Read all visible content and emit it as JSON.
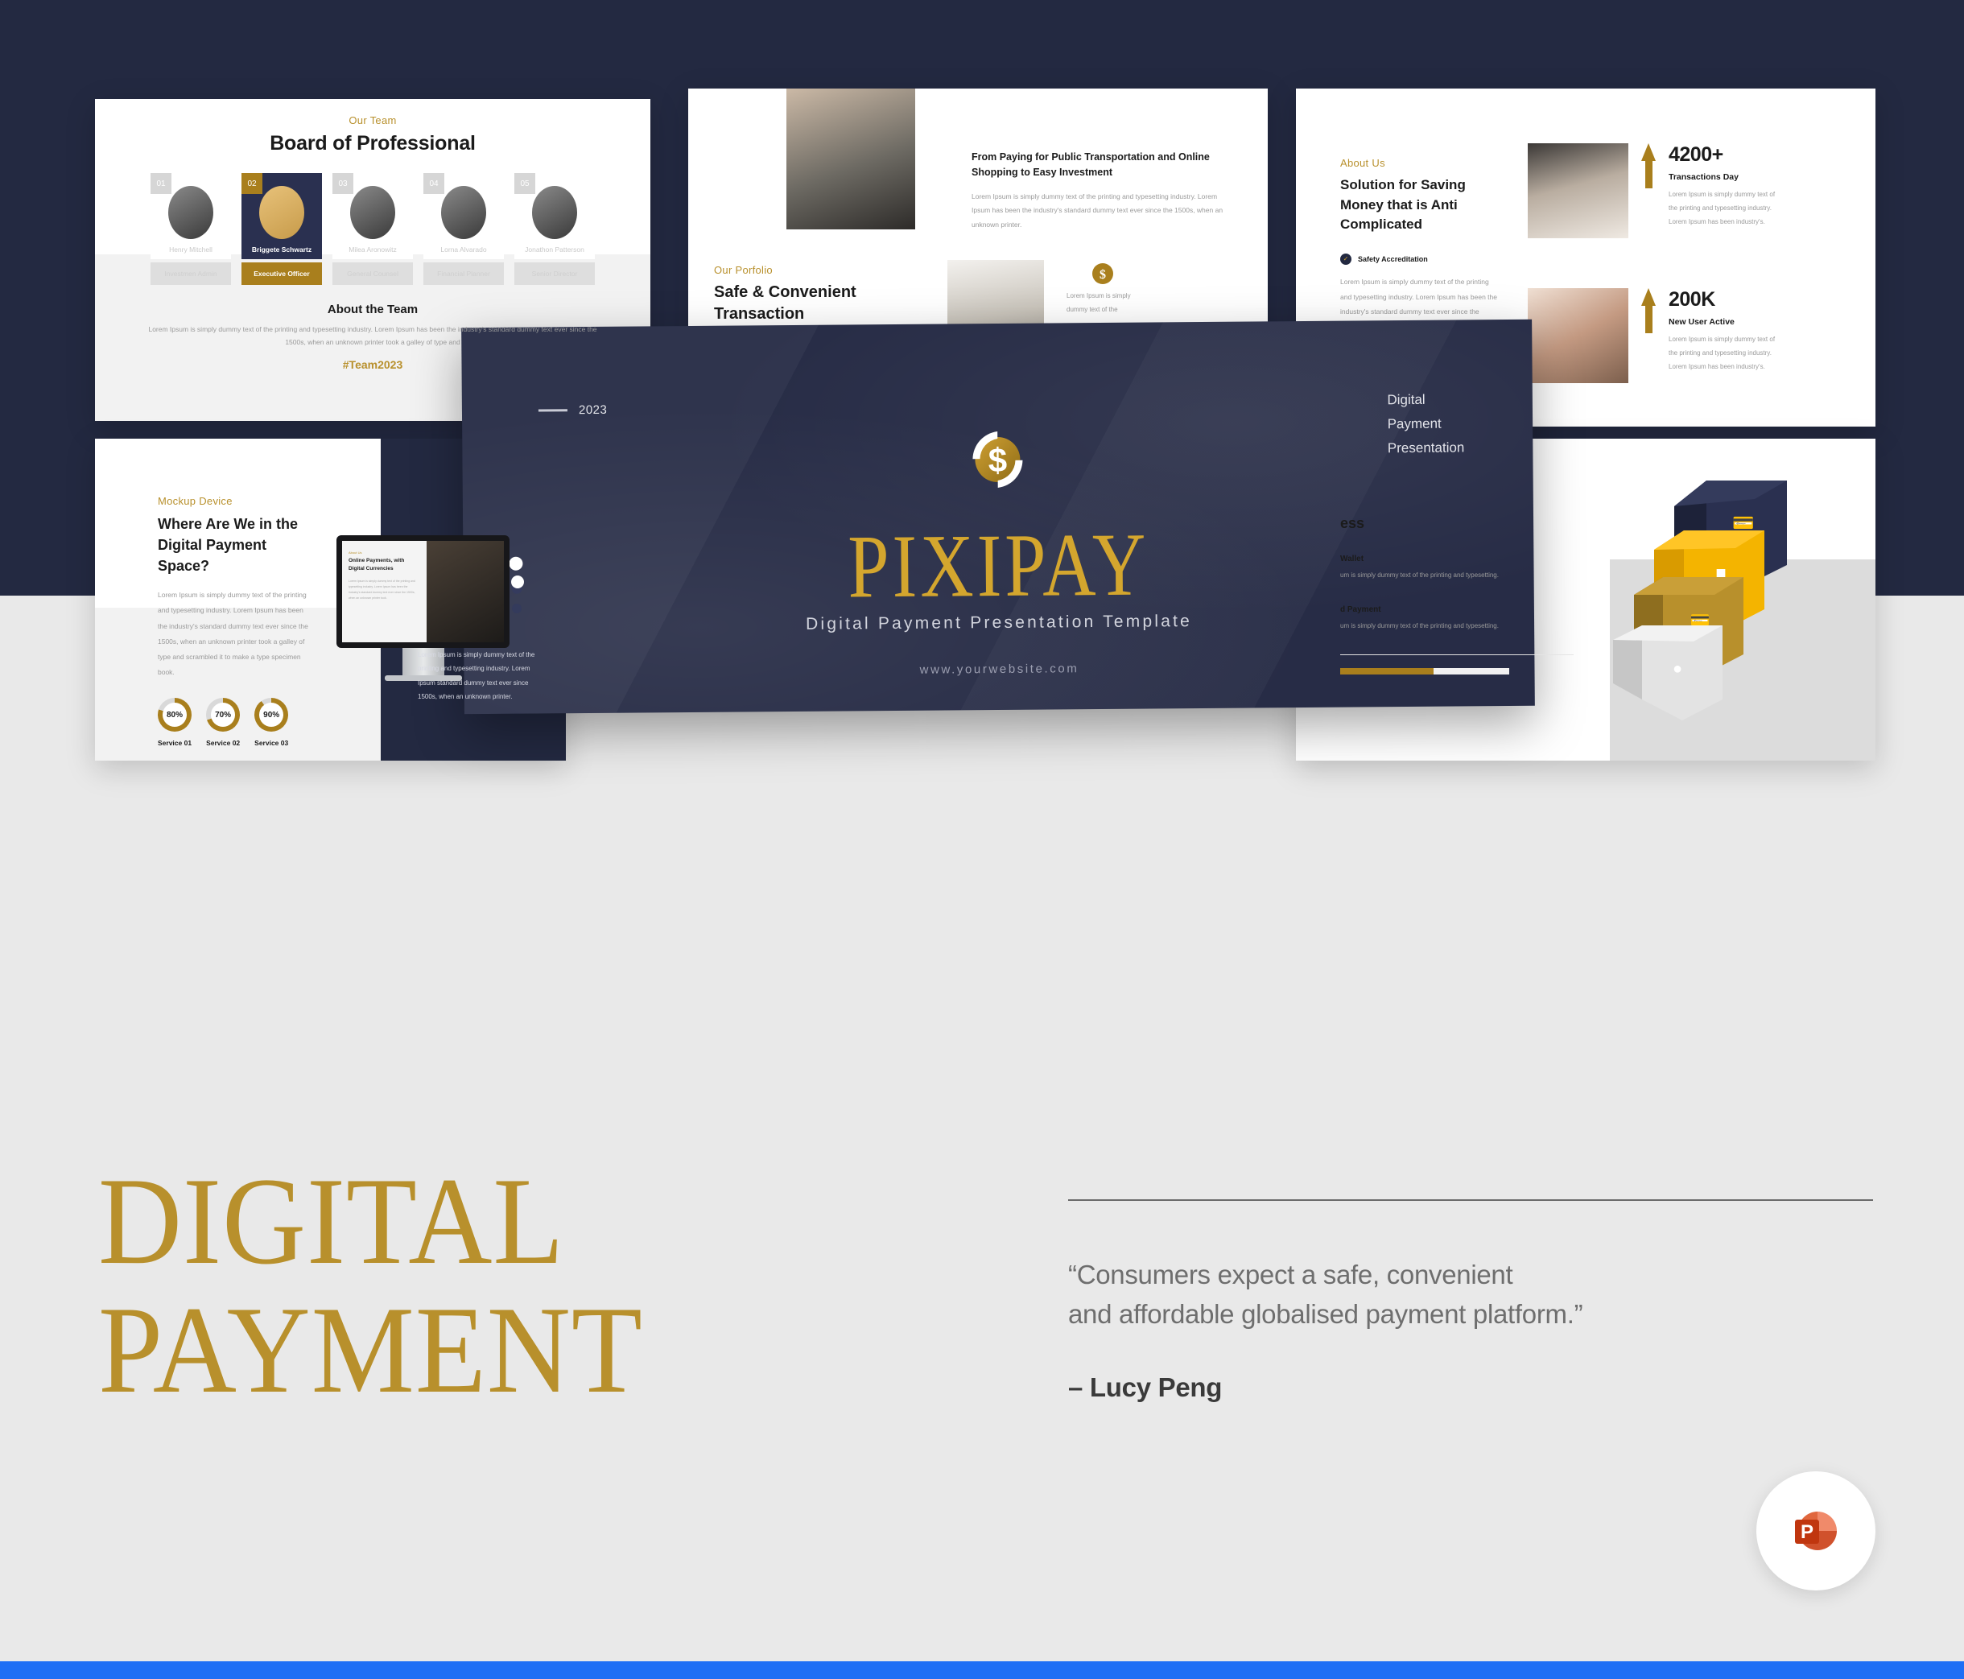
{
  "theme": {
    "navy": "#232941",
    "gold": "#b8902c",
    "gold_bright": "#d4a62e",
    "grey_bg": "#e9e9e9",
    "blue_bar": "#1f6ff5"
  },
  "hero": {
    "year": "2023",
    "corner_label": "Digital\nPayment\nPresentation",
    "corner_line1": "Digital",
    "corner_line2": "Payment",
    "corner_line3": "Presentation",
    "title": "PIXIPAY",
    "subtitle": "Digital Payment Presentation Template",
    "url": "www.yourwebsite.com",
    "logo_icon": "dollar-coin-icon"
  },
  "slide_team": {
    "eyebrow": "Our Team",
    "title": "Board of Professional",
    "members": [
      {
        "num": "01",
        "name": "Henry Mitchell",
        "role": "Investmen Admin"
      },
      {
        "num": "02",
        "name": "Briggete Schwartz",
        "role": "Executive Officer"
      },
      {
        "num": "03",
        "name": "Milea Aronowitz",
        "role": "General Counsel"
      },
      {
        "num": "04",
        "name": "Lorna Alvarado",
        "role": "Financial Planner"
      },
      {
        "num": "05",
        "name": "Jonathon Patterson",
        "role": "Senior Director"
      }
    ],
    "about_title": "About the Team",
    "about_body": "Lorem Ipsum is simply dummy text of the printing and typesetting industry.  Lorem Ipsum has been the industry's standard dummy text ever since the 1500s,  when an unknown printer took a galley of type and",
    "hashtag": "#Team2023"
  },
  "slide_portfolio": {
    "headline": "From Paying for Public Transportation and Online Shopping to Easy Investment",
    "body": "Lorem Ipsum is simply dummy text of the printing and typesetting industry.  Lorem Ipsum has been the industry's standard dummy text ever since the 1500s,  when an unknown printer.",
    "eyebrow": "Our Porfolio",
    "title_line1": "Safe & Convenient",
    "title_line2": "Transaction",
    "coin_caption": "Lorem Ipsum is simply dummy text of the"
  },
  "slide_about": {
    "eyebrow": "About Us",
    "title": "Solution for Saving Money that is Anti Complicated",
    "accreditation": "Safety Accreditation",
    "body": "Lorem Ipsum is simply dummy text of the printing and typesetting industry.  Lorem Ipsum has been the industry's standard dummy text ever since the 1500s,  when an",
    "stats": [
      {
        "value": "4200+",
        "label": "Transactions Day",
        "text": "Lorem Ipsum is simply dummy text of the printing and typesetting industry. Lorem Ipsum has been industry's."
      },
      {
        "value": "200K",
        "label": "New User Active",
        "text": "Lorem Ipsum is simply dummy text of the printing and typesetting industry. Lorem Ipsum has been industry's."
      }
    ]
  },
  "slide_mockup": {
    "eyebrow": "Mockup Device",
    "title": "Where Are We in the Digital Payment Space?",
    "body": "Lorem Ipsum is simply dummy text of the printing and typesetting industry.  Lorem Ipsum has been the industry's standard dummy text ever since the 1500s,  when an unknown printer took a galley of type and scrambled it to make a type specimen book.",
    "donuts": [
      {
        "value": "80%",
        "label": "Service 01",
        "pct": 80
      },
      {
        "value": "70%",
        "label": "Service 02",
        "pct": 70
      },
      {
        "value": "90%",
        "label": "Service 03",
        "pct": 90
      }
    ],
    "screen": {
      "eyebrow": "About Us",
      "title": "Online Payments, with Digital Currencies",
      "body": "Lorem Ipsum is simply dummy text of the printing and typesetting industry. Lorem Ipsum has been the industry's standard dummy text ever since the 1500s, when an unknown printer took."
    },
    "navy_text": "Lorem Ipsum is simply dummy text of the printing and typesetting industry. Lorem Ipsum standard dummy text ever since 1500s, when an unknown printer."
  },
  "slide_iso": {
    "title_partial": "ess",
    "items": [
      {
        "title_partial": "Wallet",
        "body": "um is simply dummy text of the printing and typesetting."
      },
      {
        "title_partial": "d Payment",
        "body": "um is simply dummy text of the printing and typesetting."
      }
    ],
    "progress_pct": 55,
    "icons": [
      "credit-card-hand-icon",
      "gold-bars-icon",
      "mobile-payment-icon",
      "coin-in-hand-icon"
    ]
  },
  "bottom": {
    "title_line1": "DIGITAL",
    "title_line2": "PAYMENT",
    "quote_line1": "“Consumers expect a safe, convenient",
    "quote_line2": "and affordable globalised payment platform.”",
    "author": "– Lucy Peng",
    "badge_icon": "powerpoint-icon"
  }
}
